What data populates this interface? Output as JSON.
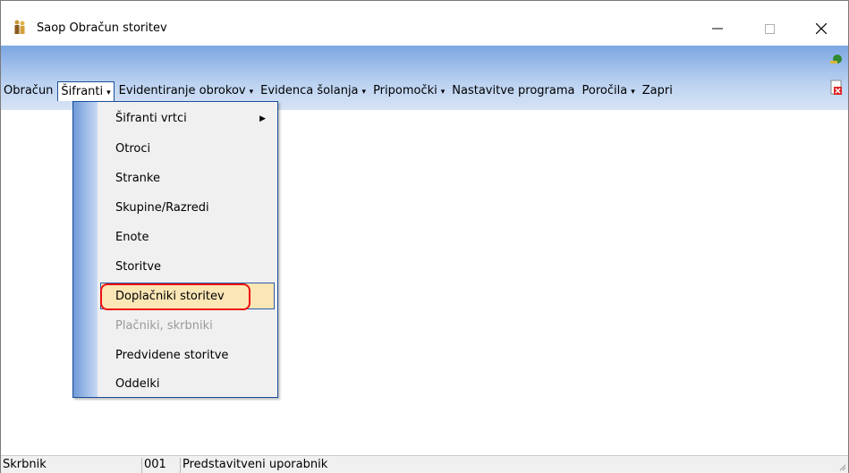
{
  "window": {
    "title": "Saop Obračun storitev",
    "icon": "app-people-icon",
    "controls": {
      "minimize": "—",
      "maximize": "☐",
      "close": "✕"
    }
  },
  "menubar": {
    "items": [
      {
        "label": "Obračun",
        "underline": "O"
      },
      {
        "label": "Šifranti",
        "underline": "Š",
        "has_arrow": true,
        "active": true
      },
      {
        "label": "Evidentiranje obrokov",
        "underline": "E",
        "has_arrow": true
      },
      {
        "label": "Evidenca šolanja",
        "underline": "v",
        "has_arrow": true
      },
      {
        "label": "Pripomočki",
        "underline": "m",
        "has_arrow": true
      },
      {
        "label": "Nastavitve programa",
        "underline": "N"
      },
      {
        "label": "Poročila",
        "underline": "r",
        "has_arrow": true
      },
      {
        "label": "Zapri",
        "underline": "Z"
      }
    ],
    "arrow_glyph": "▾"
  },
  "right_icons": [
    "key-person-icon",
    "close-document-icon"
  ],
  "sifranti_menu": {
    "items": [
      {
        "label": "Šifranti vrtci",
        "submenu": true
      },
      {
        "label": "Otroci"
      },
      {
        "label": "Stranke"
      },
      {
        "label": "Skupine/Razredi"
      },
      {
        "label": "Enote"
      },
      {
        "label": "Storitve"
      },
      {
        "label": "Doplačniki storitev",
        "highlighted": true
      },
      {
        "label": "Plačniki, skrbniki",
        "disabled": true
      },
      {
        "label": "Predvidene storitve"
      },
      {
        "label": "Oddelki"
      }
    ],
    "submenu_arrow": "▶"
  },
  "statusbar": {
    "user": "Skrbnik",
    "code": "001",
    "name": "Predstavitveni uporabnik"
  },
  "colors": {
    "banner_top": "#7ca6e2",
    "highlight_bg": "#fbe6b6",
    "highlight_border": "#2a5baa",
    "annotation_ring": "#e11111"
  }
}
